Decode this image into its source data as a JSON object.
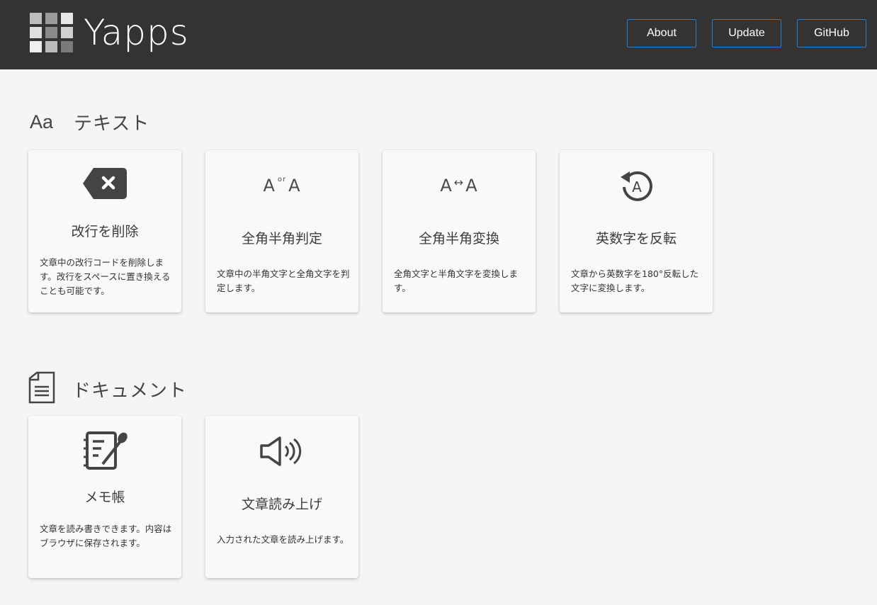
{
  "header": {
    "logo_text": "Yapps",
    "logo_colors": [
      "#bdbdbd",
      "#9a9a9a",
      "#e6e6e6",
      "#e0e0e0",
      "#8a8a8a",
      "#d0d0d0",
      "#efefef",
      "#bbbbbb",
      "#7a7a7a"
    ],
    "nav": [
      {
        "label": "About"
      },
      {
        "label": "Update"
      },
      {
        "label": "GitHub"
      }
    ],
    "accent": "#1e7fd6"
  },
  "sections": [
    {
      "icon": "Aa",
      "title": "テキスト",
      "cards": [
        {
          "icon": "backspace-icon",
          "title": "改行を削除",
          "desc": "文章中の改行コードを削除します。改行をスペースに置き換えることも可能です。"
        },
        {
          "icon": "a-or-a-icon",
          "icon_text": {
            "left": "A",
            "mid": "or",
            "right": "A"
          },
          "title": "全角半角判定",
          "desc": "文章中の半角文字と全角文字を判定します。"
        },
        {
          "icon": "a-swap-a-icon",
          "icon_text": {
            "left": "A",
            "mid": "↔",
            "right": "A"
          },
          "title": "全角半角変換",
          "desc": "全角文字と半角文字を変換します。"
        },
        {
          "icon": "rotate-a-icon",
          "icon_text": {
            "letter": "A"
          },
          "title": "英数字を反転",
          "desc": "文章から英数字を180°反転した文字に変換します。"
        }
      ]
    },
    {
      "icon": "document-icon",
      "title": "ドキュメント",
      "cards": [
        {
          "icon": "notepad-icon",
          "title": "メモ帳",
          "desc": "文章を読み書きできます。内容はブラウザに保存されます。"
        },
        {
          "icon": "speaker-icon",
          "title": "文章読み上げ",
          "desc": "入力された文章を読み上げます。"
        }
      ]
    }
  ]
}
